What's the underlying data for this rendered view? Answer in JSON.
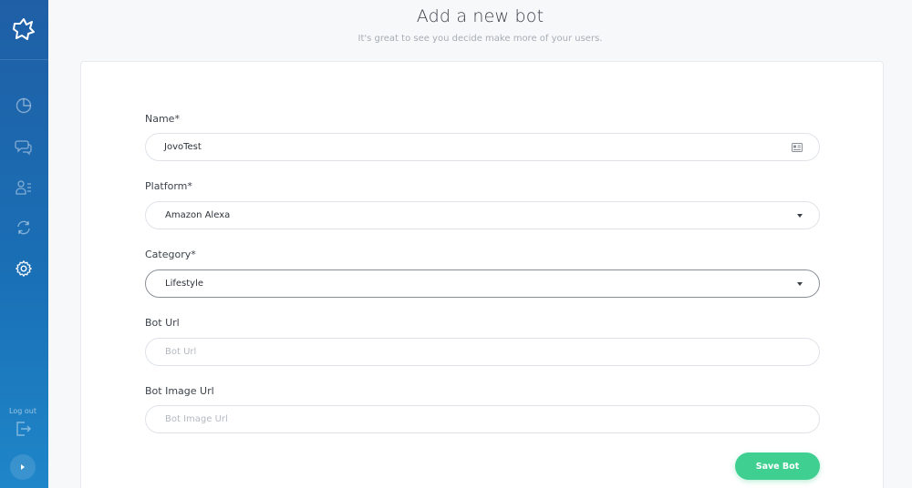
{
  "sidebar": {
    "items": [
      {
        "name": "dashboard",
        "icon": "pie-chart-icon"
      },
      {
        "name": "conversations",
        "icon": "chat-bubbles-icon"
      },
      {
        "name": "users",
        "icon": "user-list-icon"
      },
      {
        "name": "sync",
        "icon": "refresh-icon"
      },
      {
        "name": "settings",
        "icon": "gear-icon",
        "active": true
      }
    ],
    "logout_label": "Log out"
  },
  "header": {
    "title": "Add a new bot",
    "subtitle": "It's great to see you decide make more of your users."
  },
  "form": {
    "name": {
      "label": "Name*",
      "value": "JovoTest"
    },
    "platform": {
      "label": "Platform*",
      "value": "Amazon Alexa"
    },
    "category": {
      "label": "Category*",
      "value": "Lifestyle"
    },
    "bot_url": {
      "label": "Bot Url",
      "placeholder": "Bot Url"
    },
    "bot_image_url": {
      "label": "Bot Image Url",
      "placeholder": "Bot Image Url"
    },
    "save_label": "Save Bot"
  },
  "colors": {
    "sidebar_top": "#1f5fa6",
    "sidebar_bottom": "#1f86c9",
    "accent_green": "#3fcf91"
  }
}
